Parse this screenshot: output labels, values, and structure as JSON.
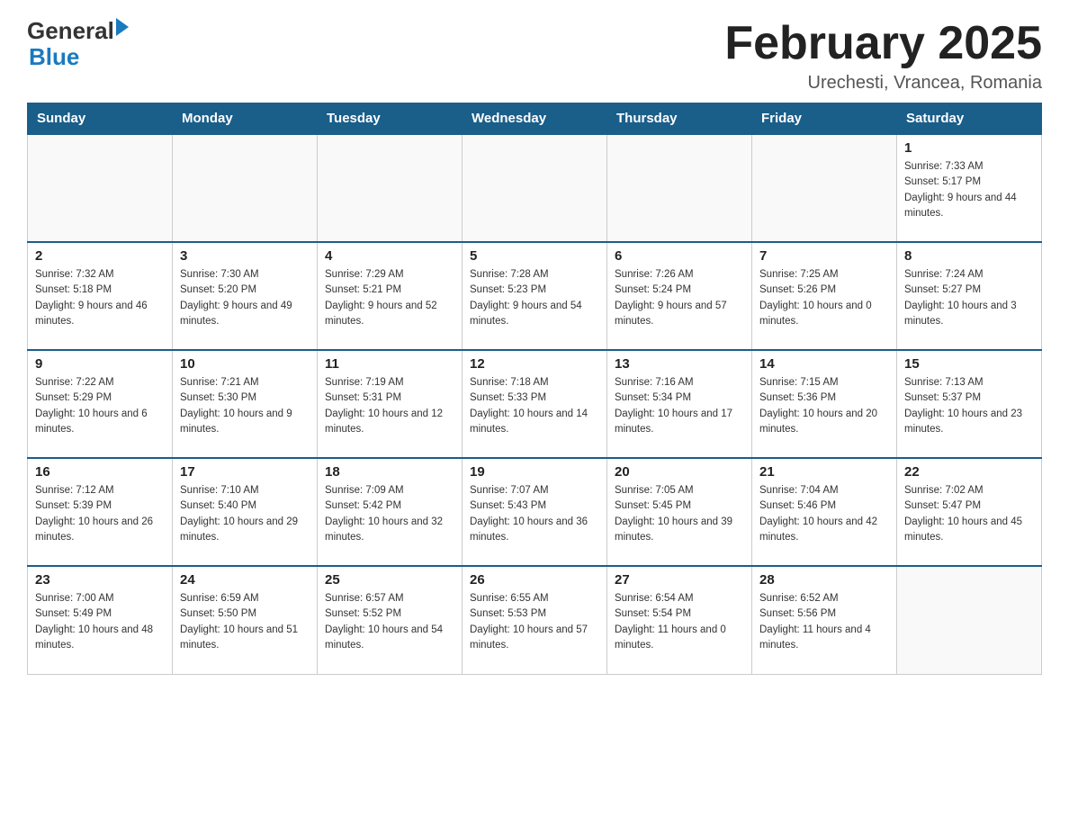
{
  "header": {
    "logo_general": "General",
    "logo_blue": "Blue",
    "title": "February 2025",
    "location": "Urechesti, Vrancea, Romania"
  },
  "calendar": {
    "days_of_week": [
      "Sunday",
      "Monday",
      "Tuesday",
      "Wednesday",
      "Thursday",
      "Friday",
      "Saturday"
    ],
    "weeks": [
      [
        {
          "day": "",
          "info": ""
        },
        {
          "day": "",
          "info": ""
        },
        {
          "day": "",
          "info": ""
        },
        {
          "day": "",
          "info": ""
        },
        {
          "day": "",
          "info": ""
        },
        {
          "day": "",
          "info": ""
        },
        {
          "day": "1",
          "info": "Sunrise: 7:33 AM\nSunset: 5:17 PM\nDaylight: 9 hours and 44 minutes."
        }
      ],
      [
        {
          "day": "2",
          "info": "Sunrise: 7:32 AM\nSunset: 5:18 PM\nDaylight: 9 hours and 46 minutes."
        },
        {
          "day": "3",
          "info": "Sunrise: 7:30 AM\nSunset: 5:20 PM\nDaylight: 9 hours and 49 minutes."
        },
        {
          "day": "4",
          "info": "Sunrise: 7:29 AM\nSunset: 5:21 PM\nDaylight: 9 hours and 52 minutes."
        },
        {
          "day": "5",
          "info": "Sunrise: 7:28 AM\nSunset: 5:23 PM\nDaylight: 9 hours and 54 minutes."
        },
        {
          "day": "6",
          "info": "Sunrise: 7:26 AM\nSunset: 5:24 PM\nDaylight: 9 hours and 57 minutes."
        },
        {
          "day": "7",
          "info": "Sunrise: 7:25 AM\nSunset: 5:26 PM\nDaylight: 10 hours and 0 minutes."
        },
        {
          "day": "8",
          "info": "Sunrise: 7:24 AM\nSunset: 5:27 PM\nDaylight: 10 hours and 3 minutes."
        }
      ],
      [
        {
          "day": "9",
          "info": "Sunrise: 7:22 AM\nSunset: 5:29 PM\nDaylight: 10 hours and 6 minutes."
        },
        {
          "day": "10",
          "info": "Sunrise: 7:21 AM\nSunset: 5:30 PM\nDaylight: 10 hours and 9 minutes."
        },
        {
          "day": "11",
          "info": "Sunrise: 7:19 AM\nSunset: 5:31 PM\nDaylight: 10 hours and 12 minutes."
        },
        {
          "day": "12",
          "info": "Sunrise: 7:18 AM\nSunset: 5:33 PM\nDaylight: 10 hours and 14 minutes."
        },
        {
          "day": "13",
          "info": "Sunrise: 7:16 AM\nSunset: 5:34 PM\nDaylight: 10 hours and 17 minutes."
        },
        {
          "day": "14",
          "info": "Sunrise: 7:15 AM\nSunset: 5:36 PM\nDaylight: 10 hours and 20 minutes."
        },
        {
          "day": "15",
          "info": "Sunrise: 7:13 AM\nSunset: 5:37 PM\nDaylight: 10 hours and 23 minutes."
        }
      ],
      [
        {
          "day": "16",
          "info": "Sunrise: 7:12 AM\nSunset: 5:39 PM\nDaylight: 10 hours and 26 minutes."
        },
        {
          "day": "17",
          "info": "Sunrise: 7:10 AM\nSunset: 5:40 PM\nDaylight: 10 hours and 29 minutes."
        },
        {
          "day": "18",
          "info": "Sunrise: 7:09 AM\nSunset: 5:42 PM\nDaylight: 10 hours and 32 minutes."
        },
        {
          "day": "19",
          "info": "Sunrise: 7:07 AM\nSunset: 5:43 PM\nDaylight: 10 hours and 36 minutes."
        },
        {
          "day": "20",
          "info": "Sunrise: 7:05 AM\nSunset: 5:45 PM\nDaylight: 10 hours and 39 minutes."
        },
        {
          "day": "21",
          "info": "Sunrise: 7:04 AM\nSunset: 5:46 PM\nDaylight: 10 hours and 42 minutes."
        },
        {
          "day": "22",
          "info": "Sunrise: 7:02 AM\nSunset: 5:47 PM\nDaylight: 10 hours and 45 minutes."
        }
      ],
      [
        {
          "day": "23",
          "info": "Sunrise: 7:00 AM\nSunset: 5:49 PM\nDaylight: 10 hours and 48 minutes."
        },
        {
          "day": "24",
          "info": "Sunrise: 6:59 AM\nSunset: 5:50 PM\nDaylight: 10 hours and 51 minutes."
        },
        {
          "day": "25",
          "info": "Sunrise: 6:57 AM\nSunset: 5:52 PM\nDaylight: 10 hours and 54 minutes."
        },
        {
          "day": "26",
          "info": "Sunrise: 6:55 AM\nSunset: 5:53 PM\nDaylight: 10 hours and 57 minutes."
        },
        {
          "day": "27",
          "info": "Sunrise: 6:54 AM\nSunset: 5:54 PM\nDaylight: 11 hours and 0 minutes."
        },
        {
          "day": "28",
          "info": "Sunrise: 6:52 AM\nSunset: 5:56 PM\nDaylight: 11 hours and 4 minutes."
        },
        {
          "day": "",
          "info": ""
        }
      ]
    ]
  }
}
